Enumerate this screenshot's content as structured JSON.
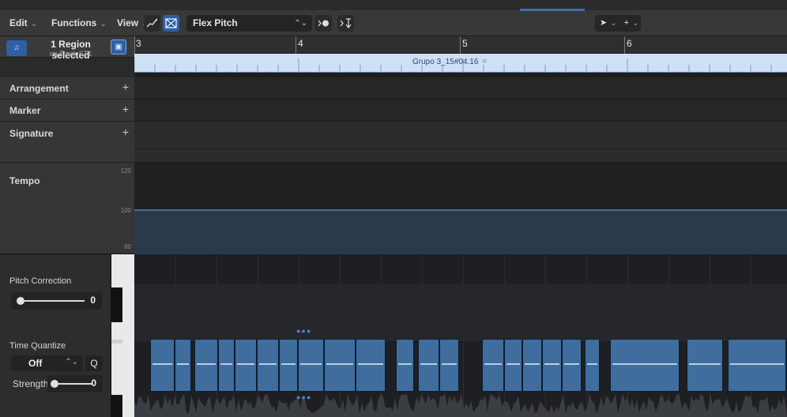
{
  "toolbar": {
    "menu_edit": "Edit",
    "menu_functions": "Functions",
    "menu_view": "View",
    "flex_mode": "Flex Pitch",
    "icons": [
      "curve-tool-icon",
      "flex-icon",
      "midi-in-icon",
      "catch-icon",
      "pointer-tool-icon",
      "crosshair-tool-icon"
    ]
  },
  "region_info": {
    "line1": "1 Region selected",
    "line2": "on Track ST1"
  },
  "global_tracks": {
    "arrangement": "Arrangement",
    "marker": "Marker",
    "signature": "Signature",
    "tempo": "Tempo",
    "tempo_scale": [
      "120",
      "100",
      "80"
    ],
    "tempo_value": 100
  },
  "ruler": {
    "bars": [
      "3",
      "4",
      "5",
      "6"
    ]
  },
  "region": {
    "name": "Grupo 3_15#04.16"
  },
  "flex_controls": {
    "pitch_correction_label": "Pitch Correction",
    "pitch_correction_value": "0",
    "time_quantize_label": "Time Quantize",
    "time_quantize_value": "Off",
    "q_label": "Q",
    "strength_label": "Strength",
    "strength_value": "0"
  },
  "colors": {
    "accent": "#2f5fa5",
    "region": "#cde0f6",
    "note": "#3f6d9e",
    "tempo_line": "#4a86c8"
  }
}
